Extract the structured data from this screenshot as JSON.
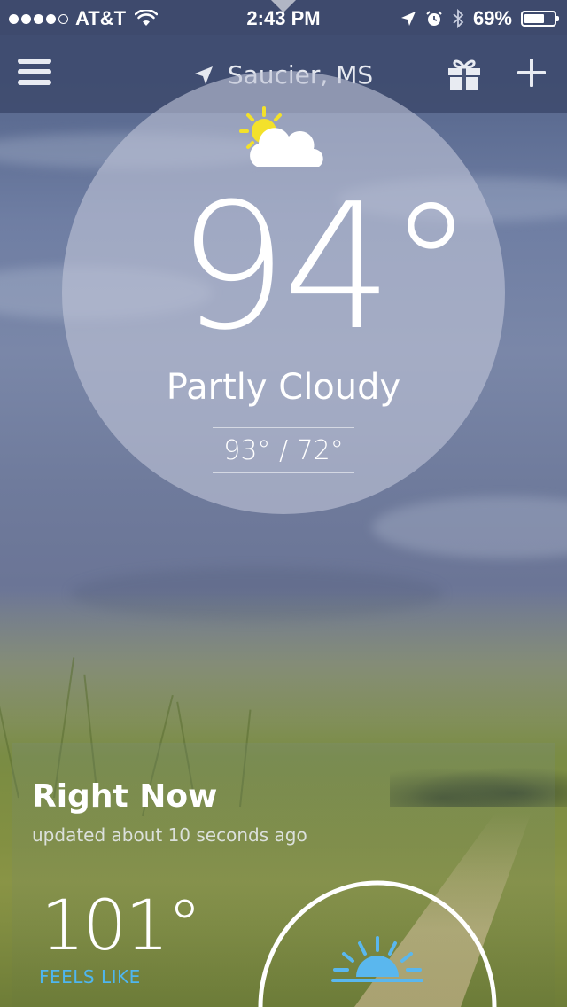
{
  "status_bar": {
    "carrier": "AT&T",
    "time": "2:43 PM",
    "battery": "69%",
    "battery_level": 0.69,
    "signal_bars_filled": 4,
    "signal_bars_total": 5
  },
  "nav": {
    "location": "Saucier, MS",
    "icons": [
      "menu-icon",
      "location-arrow-icon",
      "gift-icon",
      "plus-icon"
    ]
  },
  "current": {
    "temperature": "94°",
    "condition": "Partly Cloudy",
    "hi_lo": "93° / 72°",
    "condition_icon": "partly-cloudy-icon"
  },
  "right_now": {
    "title": "Right Now",
    "updated": "updated about 10 seconds ago",
    "feels_like_temp": "101°",
    "feels_like_label": "FEELS LIKE",
    "sun_icon": "sunrise-icon"
  },
  "colors": {
    "accent": "#4fb6ef",
    "sun_yellow": "#f3e12b",
    "nav_bg": "#3e4a6d"
  }
}
